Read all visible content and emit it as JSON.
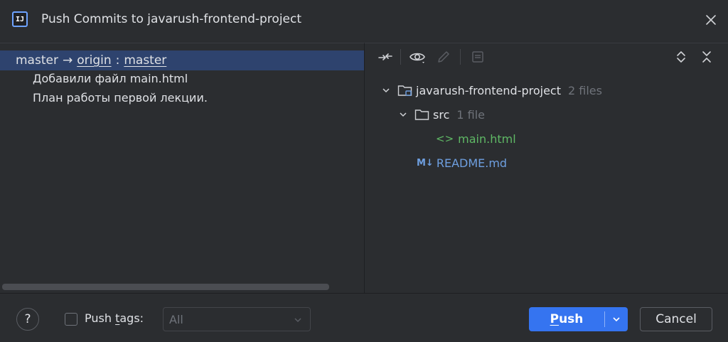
{
  "window": {
    "title": "Push Commits to javarush-frontend-project",
    "app_icon_text": "IJ"
  },
  "branch": {
    "local": "master",
    "arrow": "→",
    "remote": "origin",
    "separator": ":",
    "remote_branch": "master"
  },
  "commits": [
    {
      "message": "Добавили файл main.html"
    },
    {
      "message": "План работы первой лекции."
    }
  ],
  "toolbar": {
    "icons": [
      "collapse-arrows-icon",
      "eye-icon",
      "pencil-icon",
      "diff-icon",
      "expand-all-icon",
      "collapse-all-icon"
    ]
  },
  "tree": {
    "root": {
      "name": "javarush-frontend-project",
      "hint": "2 files"
    },
    "folder": {
      "name": "src",
      "hint": "1 file"
    },
    "files": [
      {
        "name": "main.html",
        "icon": "<>",
        "color": "#5fb865"
      },
      {
        "name": "README.md",
        "icon": "M↓",
        "color": "#6e9fe0"
      }
    ]
  },
  "footer": {
    "help": "?",
    "push_tags_label_pre": "Push ",
    "push_tags_label_mn": "t",
    "push_tags_label_post": "ags:",
    "push_tags_checked": false,
    "tags_select_value": "All",
    "push_label_mn": "P",
    "push_label_rest": "ush",
    "cancel_label": "Cancel"
  },
  "colors": {
    "background": "#2b2d30",
    "selection": "#2e436e",
    "accent": "#3574f0"
  }
}
